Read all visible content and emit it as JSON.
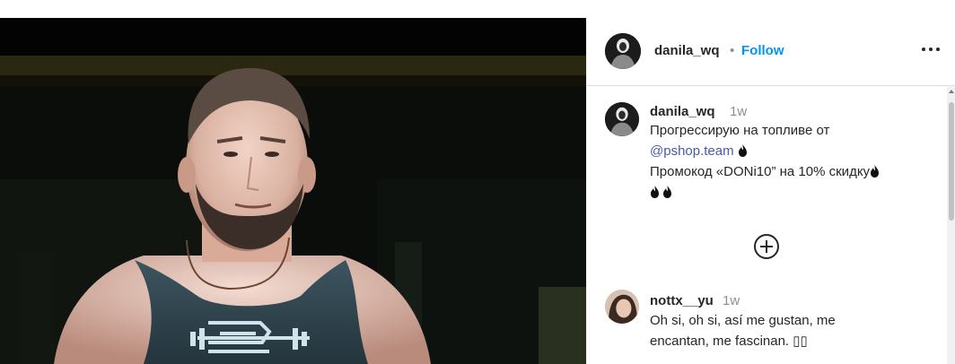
{
  "post": {
    "author": "danila_wq",
    "separator": "•",
    "follow_label": "Follow"
  },
  "caption": {
    "username": "danila_wq",
    "time": "1w",
    "line1": "Прогрессирую на топливе от",
    "mention": "@pshop.team",
    "line3": "Промокод «DONi10” на 10% скидку"
  },
  "comments": [
    {
      "username": "nottx__yu",
      "time": "1w",
      "line1": "Oh si, oh si, así me gustan, me",
      "line2": "encantan, me fascinan. ▯▯"
    }
  ],
  "icons": {
    "more": "more-options-icon",
    "flame": "fire-emoji-icon",
    "load_more": "circle-plus-icon"
  },
  "colors": {
    "accent": "#0095f6",
    "mention": "#4a5aa8",
    "muted": "#8e8e8e"
  }
}
